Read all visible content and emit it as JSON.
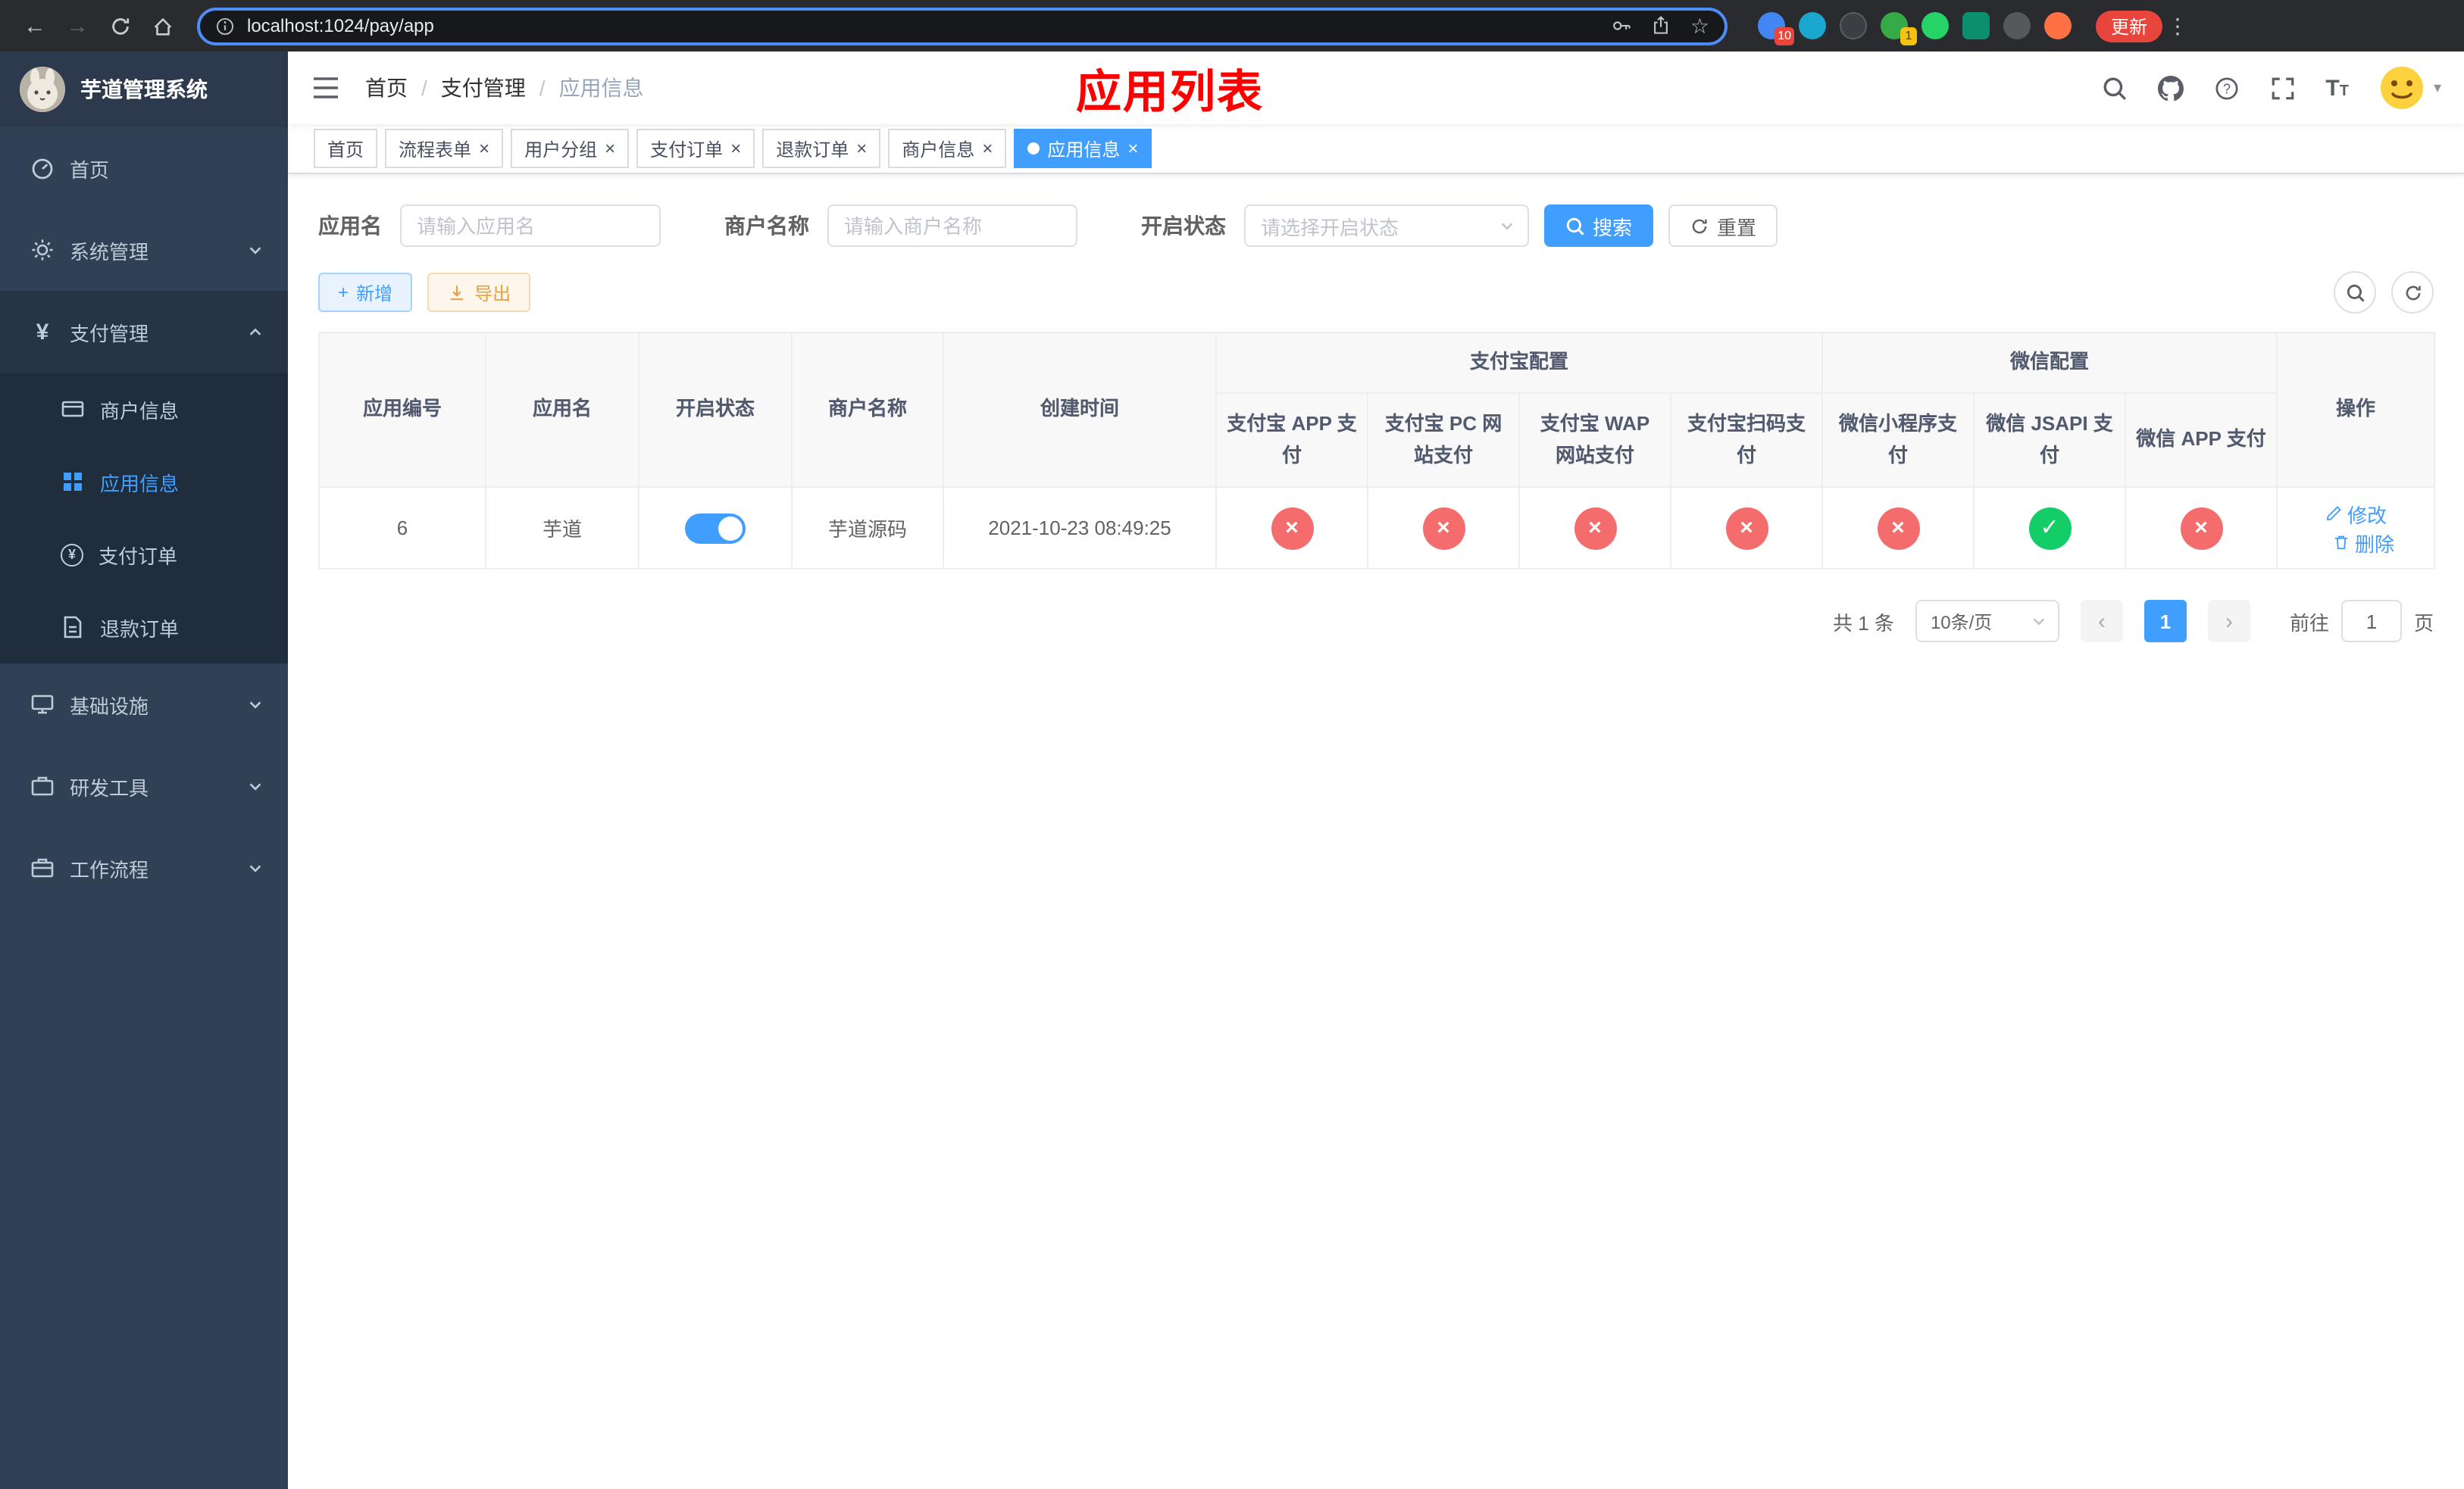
{
  "colors": {
    "accent": "#409eff",
    "danger": "#f56c6c",
    "success": "#13ce66",
    "warning": "#e6a23c",
    "sidebar_bg": "#304156",
    "sidebar_sub_bg": "#1f2d3d",
    "title_red": "#ff0000",
    "update_pill_red": "#e8453c"
  },
  "icons": {
    "back": "←",
    "forward": "→",
    "star": "☆",
    "menu_dots": "⋮",
    "caret_down": "▾",
    "plus": "+",
    "yen": "¥",
    "close": "×",
    "prev": "‹",
    "next": "›"
  },
  "browser": {
    "url": "localhost:1024/pay/app",
    "update_button": "更新",
    "extension_badge_1": "10",
    "extension_badge_2": "1"
  },
  "sidebar": {
    "logo_title": "芋道管理系统",
    "items": [
      {
        "label": "首页"
      },
      {
        "label": "系统管理"
      },
      {
        "label": "支付管理",
        "expanded": true,
        "children": [
          {
            "label": "商户信息"
          },
          {
            "label": "应用信息",
            "active": true
          },
          {
            "label": "支付订单"
          },
          {
            "label": "退款订单"
          }
        ]
      },
      {
        "label": "基础设施"
      },
      {
        "label": "研发工具"
      },
      {
        "label": "工作流程"
      }
    ]
  },
  "header": {
    "breadcrumb": [
      "首页",
      "支付管理",
      "应用信息"
    ],
    "separator": "/",
    "page_title": "应用列表"
  },
  "tabs": [
    {
      "label": "首页",
      "closable": false
    },
    {
      "label": "流程表单",
      "closable": true
    },
    {
      "label": "用户分组",
      "closable": true
    },
    {
      "label": "支付订单",
      "closable": true
    },
    {
      "label": "退款订单",
      "closable": true
    },
    {
      "label": "商户信息",
      "closable": true
    },
    {
      "label": "应用信息",
      "closable": true,
      "active": true
    }
  ],
  "filters": {
    "app_name_label": "应用名",
    "app_name_placeholder": "请输入应用名",
    "merchant_label": "商户名称",
    "merchant_placeholder": "请输入商户名称",
    "status_label": "开启状态",
    "status_placeholder": "请选择开启状态",
    "search_button": "搜索",
    "reset_button": "重置"
  },
  "toolbar": {
    "add_button": "新增",
    "export_button": "导出"
  },
  "table": {
    "columns": [
      "应用编号",
      "应用名",
      "开启状态",
      "商户名称",
      "创建时间"
    ],
    "group_alipay": "支付宝配置",
    "group_wechat": "微信配置",
    "pay_columns": [
      "支付宝 APP 支付",
      "支付宝 PC 网站支付",
      "支付宝 WAP 网站支付",
      "支付宝扫码支付",
      "微信小程序支付",
      "微信 JSAPI 支付",
      "微信 APP 支付"
    ],
    "ops_column": "操作",
    "rows": [
      {
        "id": "6",
        "name": "芋道",
        "status_on": true,
        "merchant": "芋道源码",
        "created": "2021-10-23 08:49:25",
        "pay_status": [
          "no",
          "no",
          "no",
          "no",
          "no",
          "yes",
          "no"
        ],
        "edit": "修改",
        "delete": "删除"
      }
    ]
  },
  "pagination": {
    "total": "共 1 条",
    "page_size": "10条/页",
    "current_page": "1",
    "goto_label": "前往",
    "goto_value": "1",
    "page_label": "页"
  }
}
